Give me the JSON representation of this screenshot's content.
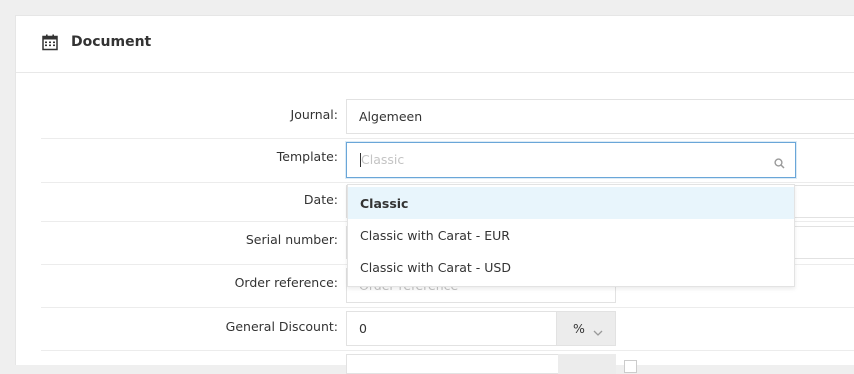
{
  "panel": {
    "title": "Document",
    "icon": "calendar-icon"
  },
  "form": {
    "journal": {
      "label": "Journal:",
      "value": "Algemeen"
    },
    "template": {
      "label": "Template:",
      "placeholder": "Classic",
      "icon": "search-icon"
    },
    "date": {
      "label": "Date:"
    },
    "serial_number": {
      "label": "Serial number:"
    },
    "order_reference": {
      "label": "Order reference:",
      "placeholder": "Order reference"
    },
    "general_discount": {
      "label": "General Discount:",
      "value": "0",
      "unit": "%"
    }
  },
  "dropdown": {
    "options": [
      {
        "label": "Classic",
        "selected": true
      },
      {
        "label": "Classic with Carat - EUR",
        "selected": false
      },
      {
        "label": "Classic with Carat - USD",
        "selected": false
      }
    ]
  },
  "colors": {
    "accent_border": "#6aa6d8",
    "highlight_bg": "#e8f5fc"
  }
}
